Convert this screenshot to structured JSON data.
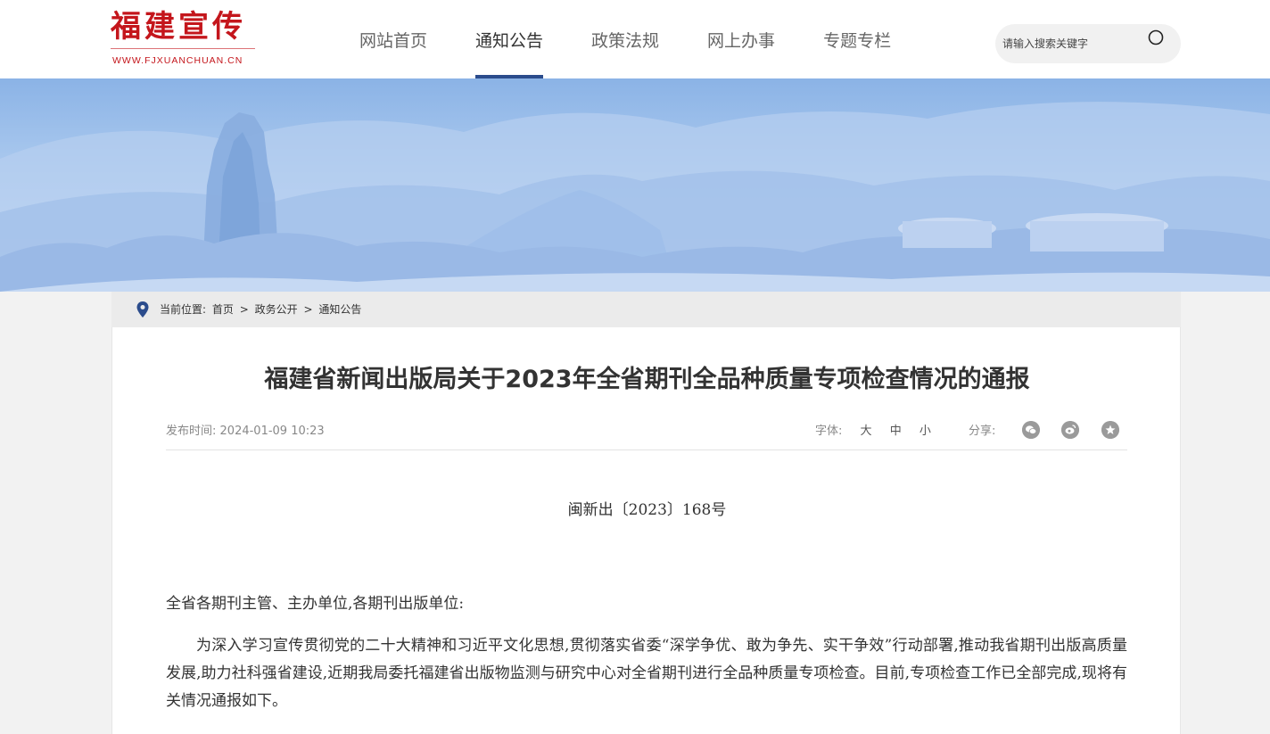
{
  "header": {
    "logo_title": "福建宣传",
    "logo_url_text": "WWW.FJXUANCHUAN.CN",
    "nav": [
      {
        "label": "网站首页"
      },
      {
        "label": "通知公告"
      },
      {
        "label": "政策法规"
      },
      {
        "label": "网上办事"
      },
      {
        "label": "专题专栏"
      }
    ],
    "active_nav": "通知公告",
    "search": {
      "placeholder": "请输入搜索关键字",
      "value": ""
    }
  },
  "breadcrumb": {
    "prefix": "当前位置:",
    "items": [
      "首页",
      "政务公开",
      "通知公告"
    ],
    "separator": ">"
  },
  "article": {
    "title": "福建省新闻出版局关于2023年全省期刊全品种质量专项检查情况的通报",
    "publish_label": "发布时间:",
    "publish_time": "2024-01-09 10:23",
    "font_label": "字体:",
    "font_sizes": [
      "大",
      "中",
      "小"
    ],
    "share_label": "分享:",
    "share_icons": [
      "wechat-icon",
      "weibo-icon",
      "qzone-icon"
    ],
    "doc_number": "闽新出〔2023〕168号",
    "salutation": "全省各期刊主管、主办单位,各期刊出版单位:",
    "paragraph_1": "为深入学习宣传贯彻党的二十大精神和习近平文化思想,贯彻落实省委“深学争优、敢为争先、实干争效”行动部署,推动我省期刊出版高质量发展,助力社科强省建设,近期我局委托福建省出版物监测与研究中心对全省期刊进行全品种质量专项检查。目前,专项检查工作已全部完成,现将有关情况通报如下。"
  },
  "colors": {
    "brand_red": "#c4161c",
    "nav_active_bar": "#2b4c8c",
    "pin_blue": "#2b4c8c"
  }
}
